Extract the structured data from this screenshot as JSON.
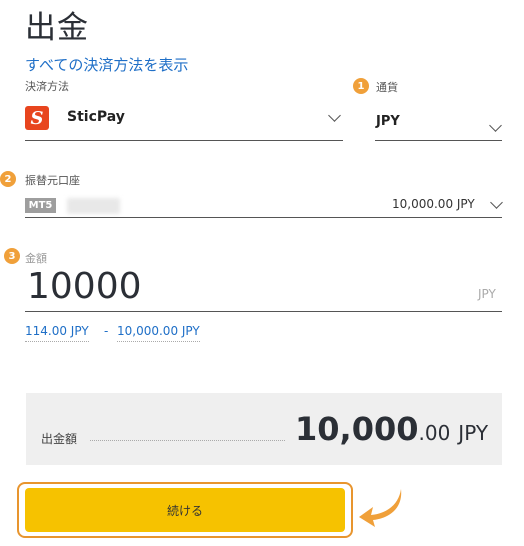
{
  "page": {
    "title": "出金",
    "show_all_methods_link": "すべての決済方法を表示"
  },
  "payment_method": {
    "label": "決済方法",
    "selected": "SticPay",
    "logo_letter": "S"
  },
  "currency": {
    "step": "1",
    "label": "通貨",
    "selected": "JPY"
  },
  "source_account": {
    "step": "2",
    "label": "振替元口座",
    "platform_badge": "MT5",
    "balance": "10,000.00 JPY"
  },
  "amount": {
    "step": "3",
    "label": "金額",
    "value": "10000",
    "unit": "JPY",
    "min": "114.00 JPY",
    "separator": "-",
    "max": "10,000.00 JPY"
  },
  "summary": {
    "label": "出金額",
    "amount_main": "10,000",
    "amount_decimal": ".00",
    "currency": "JPY"
  },
  "actions": {
    "continue_label": "続ける"
  },
  "colors": {
    "accent_orange": "#f0a03a",
    "button_yellow": "#f6c200",
    "link_blue": "#1f6fc7",
    "sticpay_red": "#e8451e"
  }
}
